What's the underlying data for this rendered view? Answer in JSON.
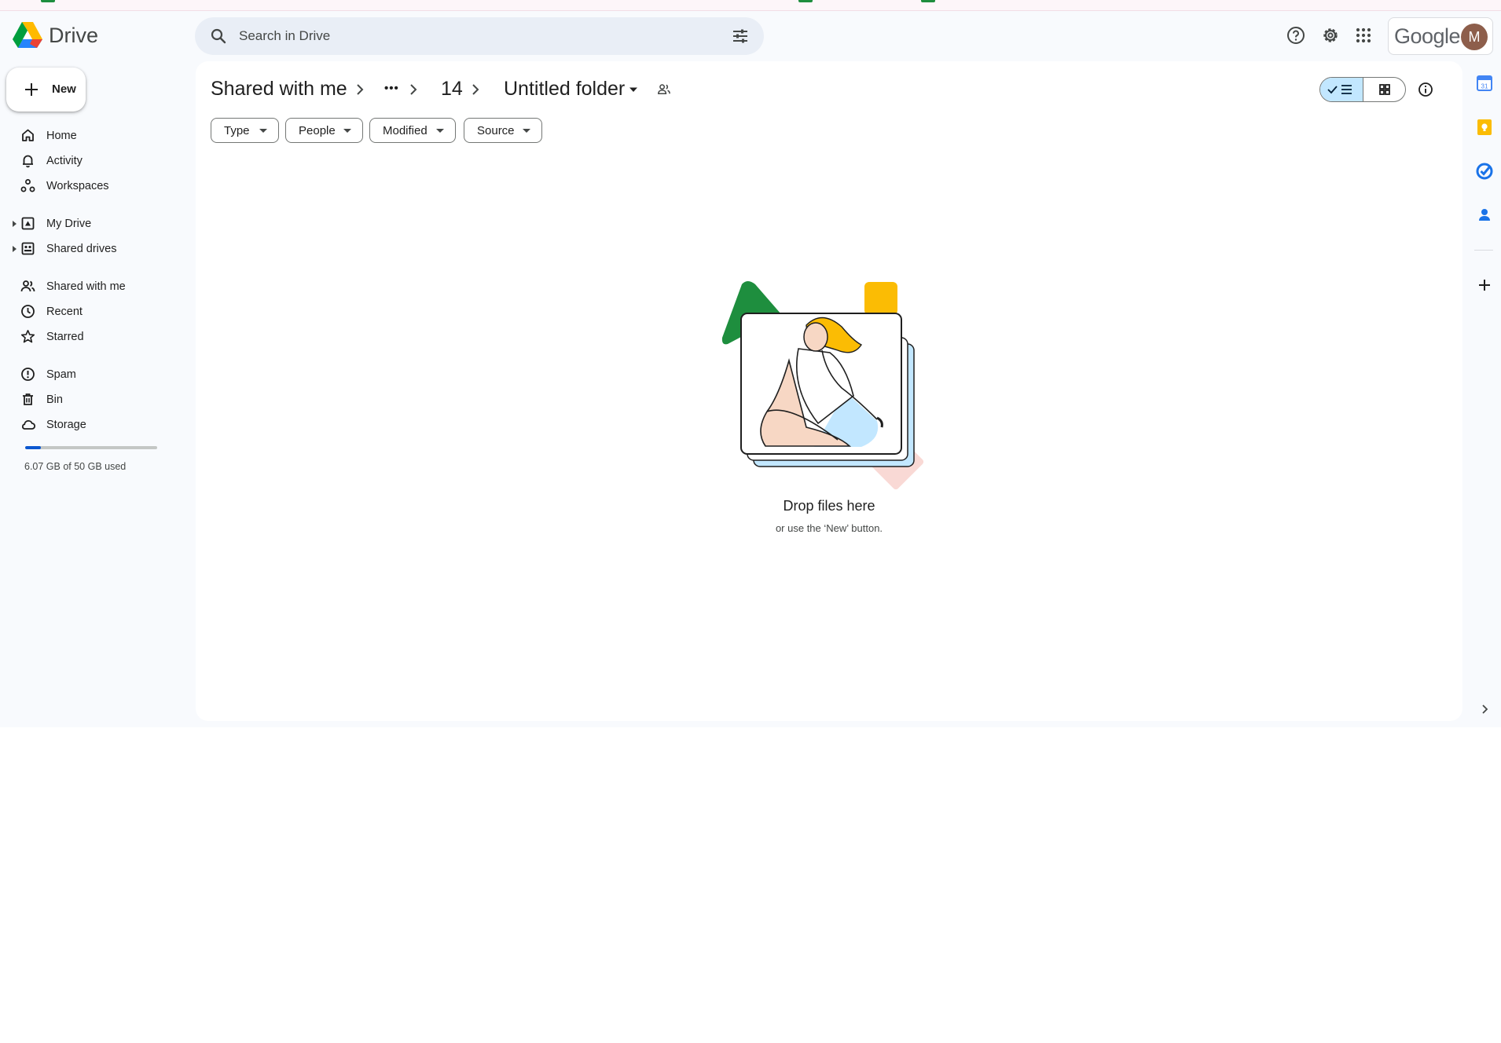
{
  "app": {
    "name": "Drive"
  },
  "search": {
    "placeholder": "Search in Drive"
  },
  "account": {
    "google_word": "Google",
    "avatar_initial": "M"
  },
  "sidebar": {
    "new_label": "New",
    "items": [
      {
        "label": "Home",
        "icon": "home-icon"
      },
      {
        "label": "Activity",
        "icon": "bell-icon"
      },
      {
        "label": "Workspaces",
        "icon": "workspaces-icon"
      },
      {
        "label": "My Drive",
        "icon": "my-drive-icon"
      },
      {
        "label": "Shared drives",
        "icon": "shared-drives-icon"
      },
      {
        "label": "Shared with me",
        "icon": "people-icon"
      },
      {
        "label": "Recent",
        "icon": "clock-icon"
      },
      {
        "label": "Starred",
        "icon": "star-icon"
      },
      {
        "label": "Spam",
        "icon": "spam-icon"
      },
      {
        "label": "Bin",
        "icon": "trash-icon"
      },
      {
        "label": "Storage",
        "icon": "cloud-icon"
      }
    ],
    "storage_text": "6.07 GB of 50 GB used",
    "storage_used_fraction": 0.12
  },
  "breadcrumb": {
    "root": "Shared with me",
    "ellipsis": "•••",
    "parent": "14",
    "current": "Untitled folder"
  },
  "filters": [
    "Type",
    "People",
    "Modified",
    "Source"
  ],
  "empty_state": {
    "title": "Drop files here",
    "subtitle": "or use the ‘New’ button."
  },
  "colors": {
    "accent": "#0b57d0",
    "selected_toggle": "#c2e7ff",
    "search_bg": "#e9eef6",
    "app_bg": "#f8fafd"
  }
}
